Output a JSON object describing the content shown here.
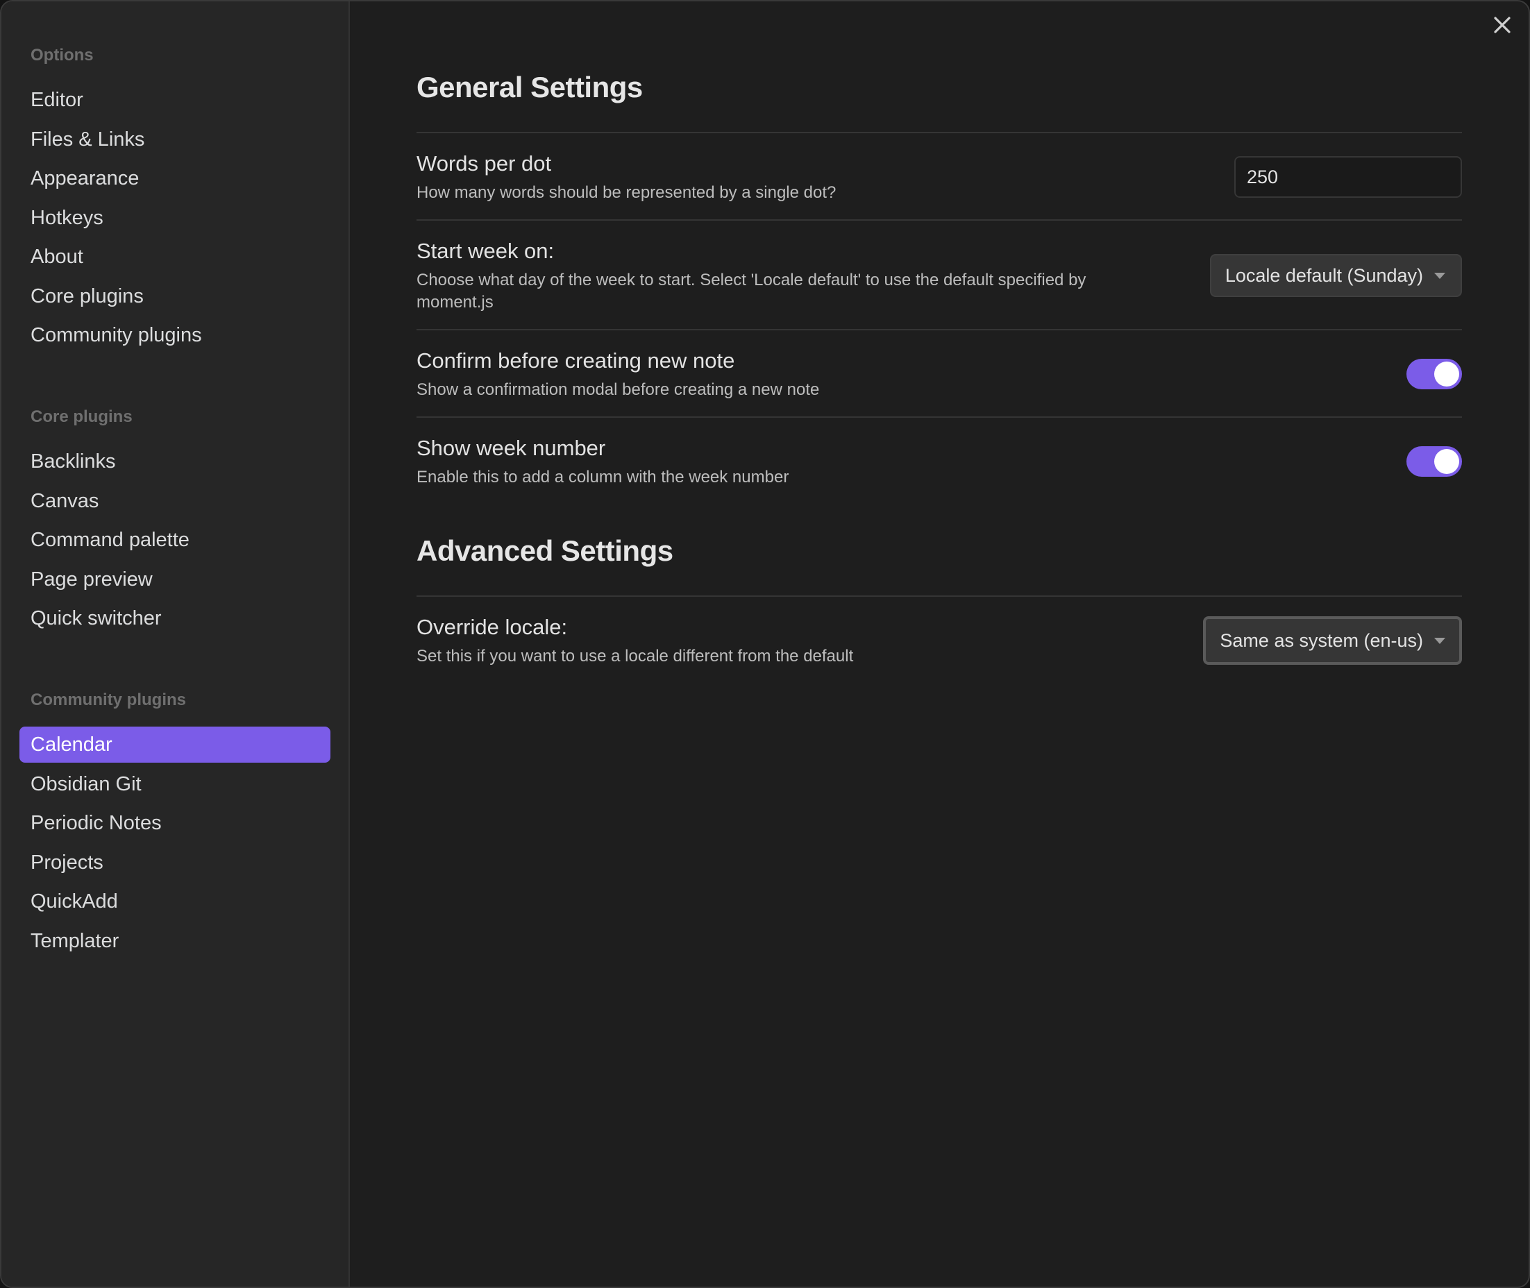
{
  "sidebar": {
    "groups": [
      {
        "title": "Options",
        "items": [
          "Editor",
          "Files & Links",
          "Appearance",
          "Hotkeys",
          "About",
          "Core plugins",
          "Community plugins"
        ]
      },
      {
        "title": "Core plugins",
        "items": [
          "Backlinks",
          "Canvas",
          "Command palette",
          "Page preview",
          "Quick switcher"
        ]
      },
      {
        "title": "Community plugins",
        "items": [
          "Calendar",
          "Obsidian Git",
          "Periodic Notes",
          "Projects",
          "QuickAdd",
          "Templater"
        ]
      }
    ],
    "active_item": "Calendar"
  },
  "general": {
    "heading": "General Settings",
    "words_per_dot": {
      "name": "Words per dot",
      "desc": "How many words should be represented by a single dot?",
      "value": "250"
    },
    "start_week": {
      "name": "Start week on:",
      "desc": "Choose what day of the week to start. Select 'Locale default' to use the default specified by moment.js",
      "selected": "Locale default (Sunday)"
    },
    "confirm_new_note": {
      "name": "Confirm before creating new note",
      "desc": "Show a confirmation modal before creating a new note",
      "enabled": true
    },
    "show_week_number": {
      "name": "Show week number",
      "desc": "Enable this to add a column with the week number",
      "enabled": true
    }
  },
  "advanced": {
    "heading": "Advanced Settings",
    "override_locale": {
      "name": "Override locale:",
      "desc": "Set this if you want to use a locale different from the default",
      "selected": "Same as system (en-us)"
    }
  },
  "icons": {
    "close": "close-icon",
    "dropdown": "chevron-down-icon"
  },
  "colors": {
    "accent": "#7b5ce8",
    "background": "#1e1e1e",
    "sidebar": "#262626"
  }
}
